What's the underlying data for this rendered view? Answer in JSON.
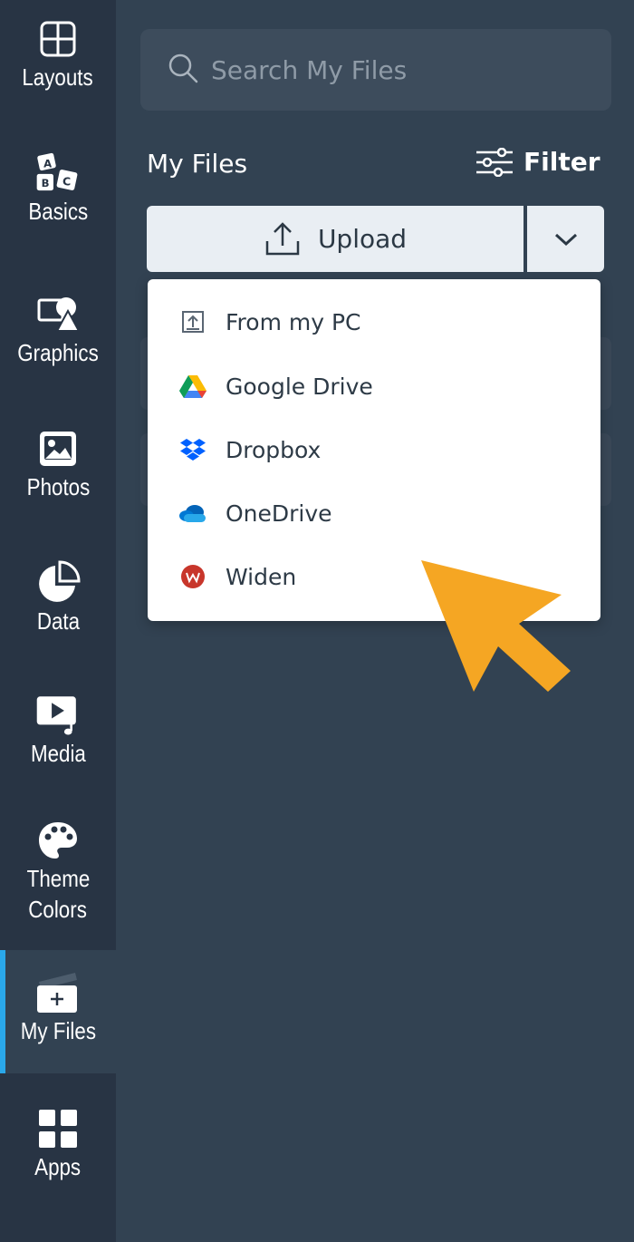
{
  "sidebar": {
    "items": [
      {
        "label": "Layouts",
        "icon": "layout-icon"
      },
      {
        "label": "Basics",
        "icon": "abc-blocks-icon"
      },
      {
        "label": "Graphics",
        "icon": "shapes-icon"
      },
      {
        "label": "Photos",
        "icon": "image-icon"
      },
      {
        "label": "Data",
        "icon": "pie-chart-icon"
      },
      {
        "label": "Media",
        "icon": "media-icon"
      },
      {
        "label": "Theme\nColors",
        "label_line1": "Theme",
        "label_line2": "Colors",
        "icon": "palette-icon"
      },
      {
        "label": "My Files",
        "icon": "folder-add-icon",
        "active": true
      },
      {
        "label": "Apps",
        "icon": "apps-grid-icon"
      }
    ]
  },
  "search": {
    "placeholder": "Search My Files"
  },
  "files": {
    "title": "My Files",
    "filter_label": "Filter",
    "upload_label": "Upload"
  },
  "upload_menu": {
    "items": [
      {
        "label": "From my PC",
        "icon": "upload-pc-icon"
      },
      {
        "label": "Google Drive",
        "icon": "google-drive-icon"
      },
      {
        "label": "Dropbox",
        "icon": "dropbox-icon"
      },
      {
        "label": "OneDrive",
        "icon": "onedrive-icon"
      },
      {
        "label": "Widen",
        "icon": "widen-icon"
      }
    ]
  },
  "colors": {
    "rail_bg": "#283444",
    "panel_bg": "#324252",
    "active_indicator": "#2aa8ea",
    "pointer_arrow": "#f5a623"
  }
}
